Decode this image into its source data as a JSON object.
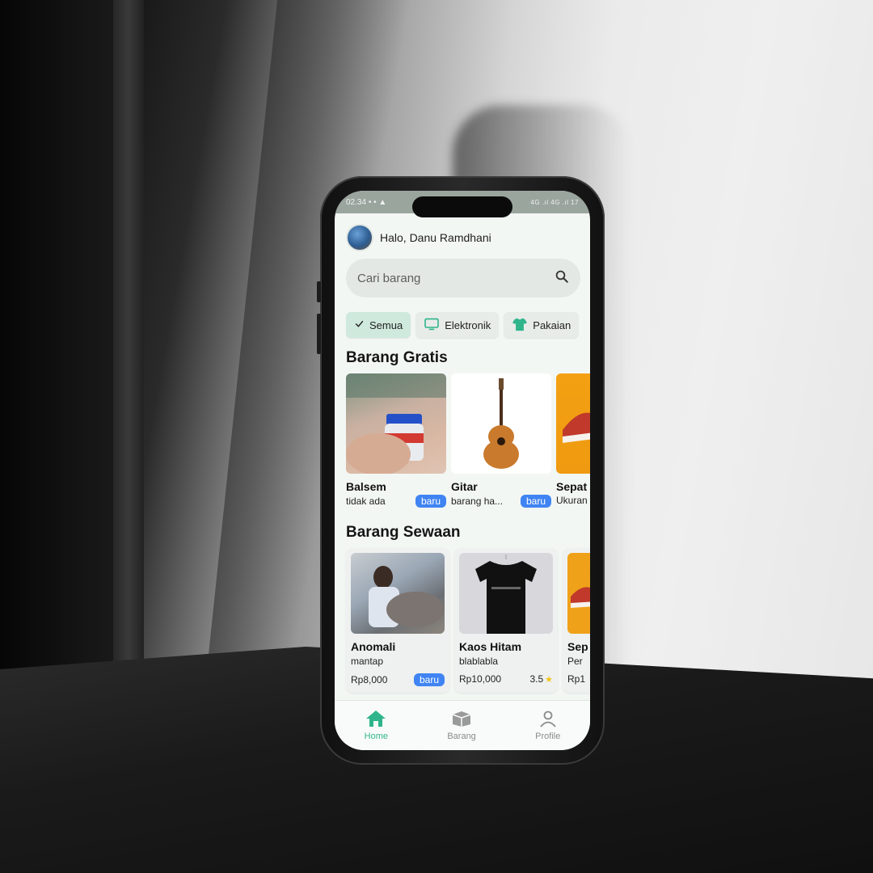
{
  "status_bar": {
    "time": "02.34",
    "indicators": "• • ▲",
    "signal": "4G .ıl 4G .ıl 17"
  },
  "header": {
    "greeting": "Halo, Danu Ramdhani"
  },
  "search": {
    "placeholder": "Cari barang"
  },
  "categories": [
    {
      "label": "Semua",
      "icon": "check-icon",
      "active": true
    },
    {
      "label": "Elektronik",
      "icon": "tv-icon",
      "active": false
    },
    {
      "label": "Pakaian",
      "icon": "shirt-icon",
      "active": false
    }
  ],
  "free_section": {
    "title": "Barang Gratis",
    "items": [
      {
        "name": "Balsem",
        "desc": "tidak ada",
        "badge": "baru"
      },
      {
        "name": "Gitar",
        "desc": "barang ha...",
        "badge": "baru"
      },
      {
        "name": "Sepat",
        "desc": "Ukuran"
      }
    ]
  },
  "rent_section": {
    "title": "Barang Sewaan",
    "items": [
      {
        "name": "Anomali",
        "desc": "mantap",
        "price": "Rp8,000",
        "badge": "baru"
      },
      {
        "name": "Kaos Hitam",
        "desc": "blablabla",
        "price": "Rp10,000",
        "rating": "3.5"
      },
      {
        "name": "Sep",
        "desc": "Per",
        "price": "Rp1"
      }
    ]
  },
  "bottom_nav": [
    {
      "label": "Home",
      "icon": "home-icon",
      "active": true
    },
    {
      "label": "Barang",
      "icon": "box-icon",
      "active": false
    },
    {
      "label": "Profile",
      "icon": "user-icon",
      "active": false
    }
  ],
  "colors": {
    "accent": "#2fb48b",
    "badge": "#3f84f2",
    "chip_active": "#cfe9dd",
    "star": "#f5c518"
  }
}
